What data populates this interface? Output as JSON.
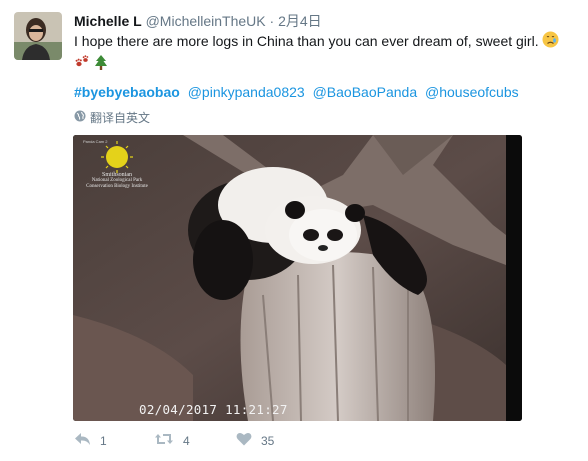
{
  "tweet": {
    "author_name": "Michelle L",
    "handle": "@MichelleinTheUK",
    "separator": "·",
    "date": "2月4日",
    "text": "I hope there are more logs in China than you can ever dream of, sweet girl.",
    "emojis": [
      "crying-face",
      "paw-prints",
      "evergreen-tree"
    ],
    "hashtags": [
      "#byebyebaobao",
      "@pinkypanda0823",
      "@BaoBaoPanda",
      "@houseofcubs"
    ],
    "translate_label": "翻译自英文",
    "media": {
      "logo_line1": "Smithsonian",
      "logo_line2": "National Zoological Park",
      "logo_line3": "Conservation Biology Institute",
      "camera_label": "Panda Cam 2",
      "timestamp": "02/04/2017 11:21:27"
    },
    "actions": {
      "reply_count": "1",
      "retweet_count": "4",
      "like_count": "35"
    }
  },
  "colors": {
    "link": "#1b95e0",
    "muted": "#657786",
    "text": "#14171a"
  }
}
